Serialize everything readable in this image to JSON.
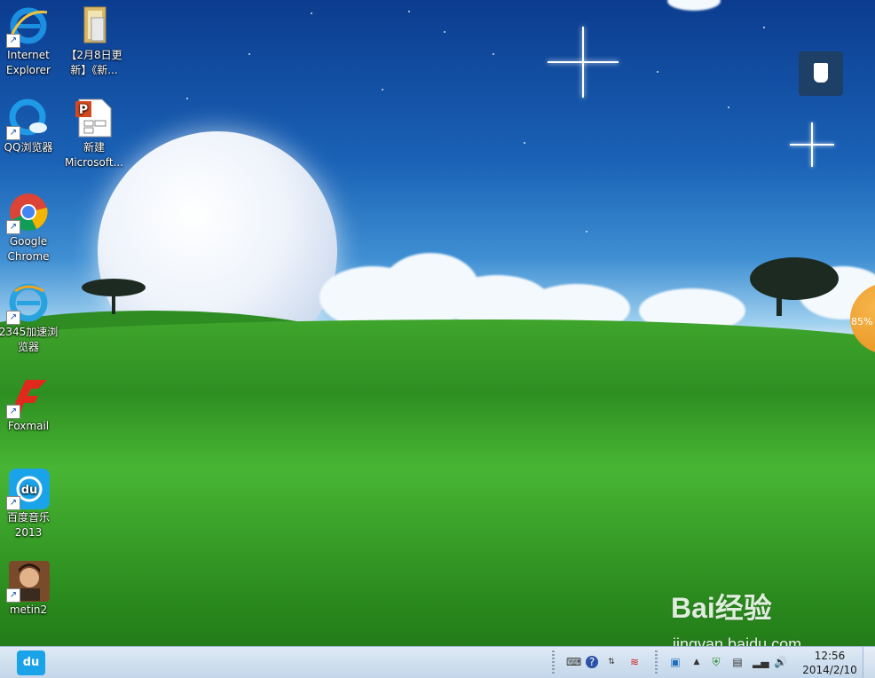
{
  "desktop_icons": [
    {
      "label_line1": "Internet",
      "label_line2": "Explorer",
      "icon": "internet-explorer-icon"
    },
    {
      "label_line1": "QQ浏览器",
      "label_line2": "",
      "icon": "qq-browser-icon"
    },
    {
      "label_line1": "Google",
      "label_line2": "Chrome",
      "icon": "chrome-icon"
    },
    {
      "label_line1": "2345加速浏",
      "label_line2": "览器",
      "icon": "2345-browser-icon"
    },
    {
      "label_line1": "Foxmail",
      "label_line2": "",
      "icon": "foxmail-icon"
    },
    {
      "label_line1": "百度音乐",
      "label_line2": "2013",
      "icon": "baidu-music-icon"
    },
    {
      "label_line1": "metin2",
      "label_line2": "",
      "icon": "metin2-icon"
    },
    {
      "label_line1": "【2月8日更",
      "label_line2": "新】《新...",
      "icon": "folder-icon"
    },
    {
      "label_line1": "新建",
      "label_line2": "Microsoft...",
      "icon": "powerpoint-file-icon"
    }
  ],
  "floating": {
    "usb_button": "usb-eject-icon",
    "ball_percent": "85%"
  },
  "watermark": {
    "logo": "Bai经验",
    "url": "jingyan.baidu.com"
  },
  "taskbar": {
    "pinned_app_label": "du",
    "clock_time": "12:56",
    "clock_date": "2014/2/10"
  },
  "colors": {
    "taskbar_bg": "#c3d6ea",
    "baidu_music_blue": "#1aa3e8"
  }
}
